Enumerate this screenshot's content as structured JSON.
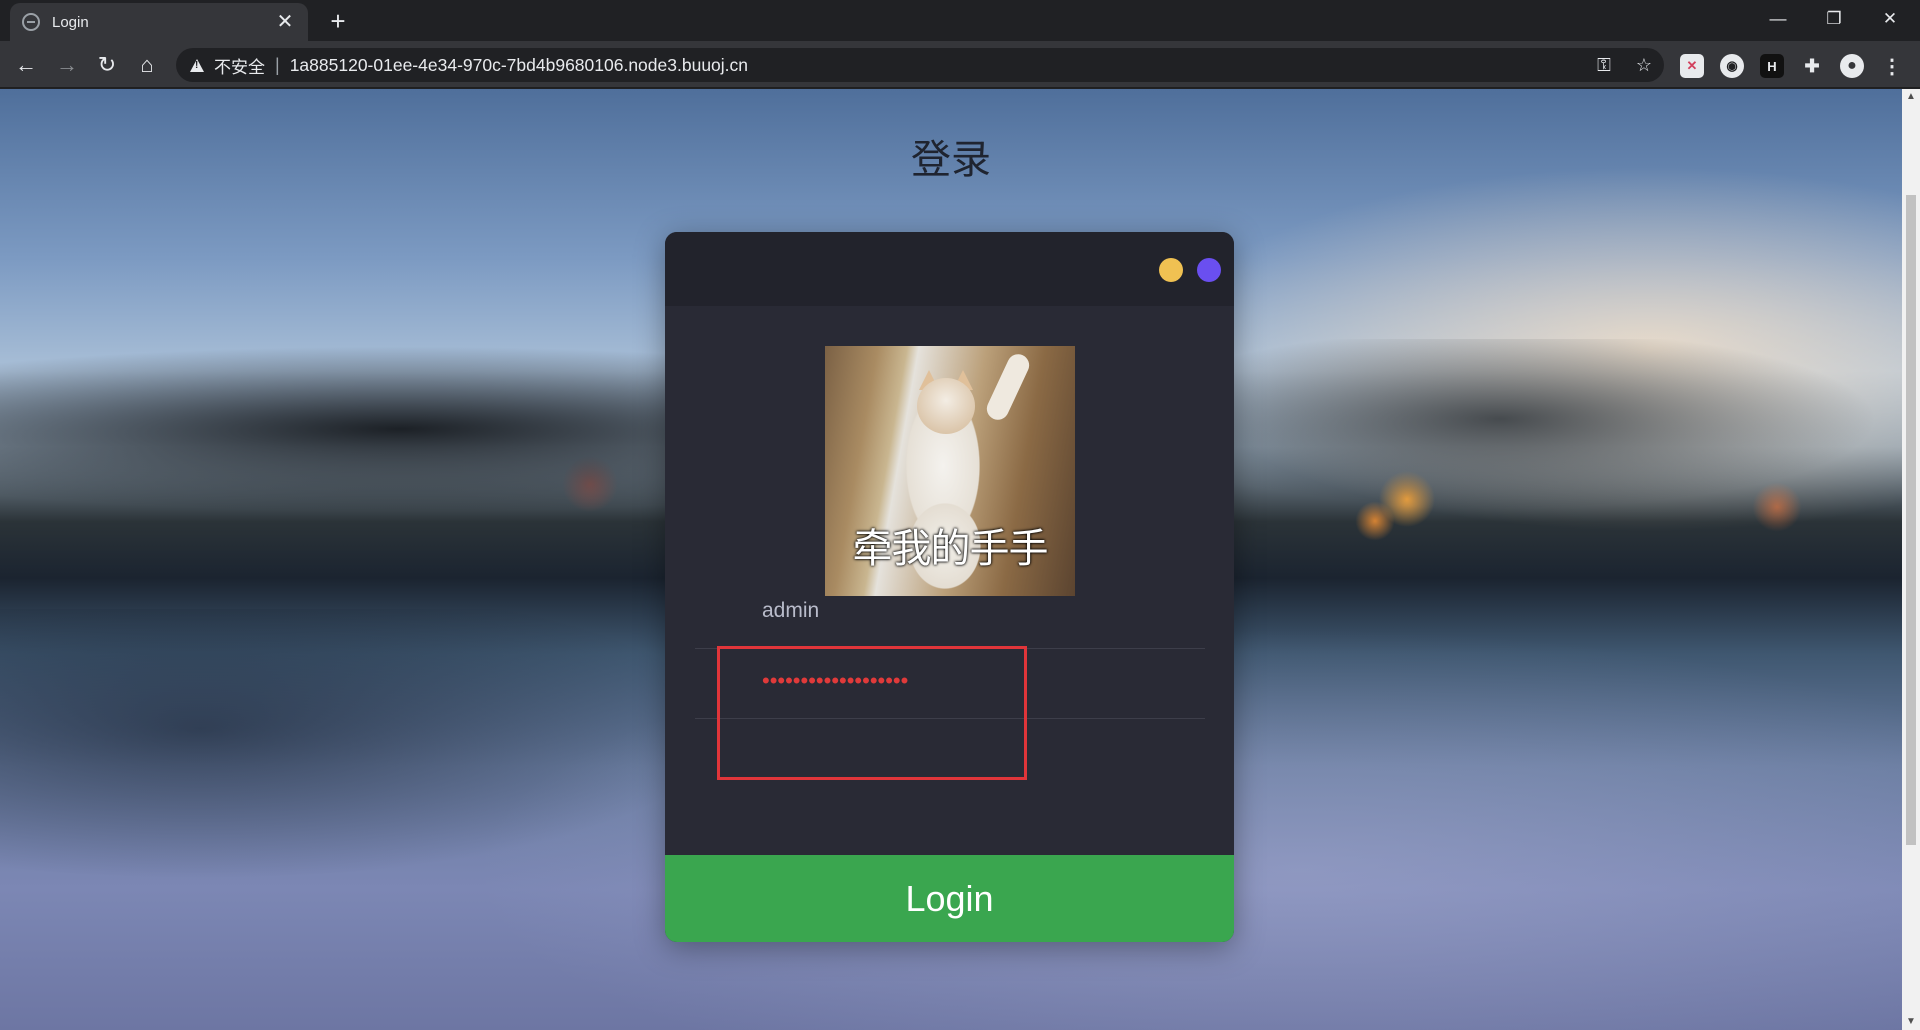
{
  "browser": {
    "tab_title": "Login",
    "new_tab_symbol": "+",
    "security_label": "不安全",
    "url": "1a885120-01ee-4e34-970c-7bd4b9680106.node3.buuoj.cn",
    "extensions": [
      "bitwarden-icon",
      "fox-icon",
      "h-icon",
      "puzzle-icon",
      "profile-icon"
    ]
  },
  "page": {
    "heading": "登录",
    "avatar_caption": "牵我的手手",
    "username_value": "admin",
    "password_value": "•••••••••••••••••••",
    "login_label": "Login",
    "dots": [
      "#f0c152",
      "#6a4ff0"
    ],
    "accent": "#3aa64f",
    "highlight": "#e0353a"
  }
}
